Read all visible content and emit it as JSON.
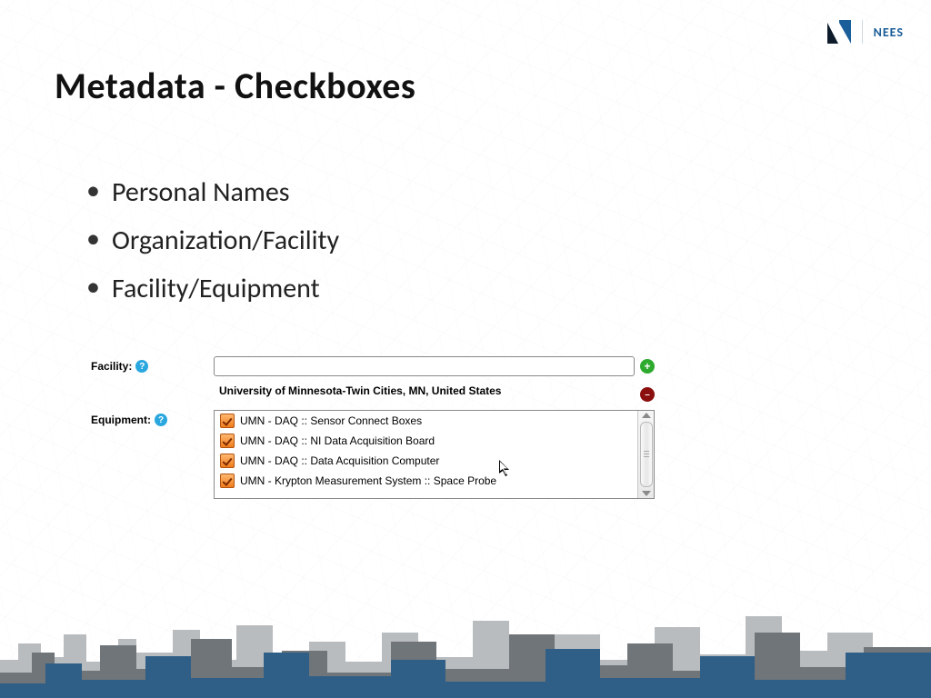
{
  "brand": "NEES",
  "title": "Metadata - Checkboxes",
  "bullets": [
    "Personal Names",
    "Organization/Facility",
    "Facility/Equipment"
  ],
  "form": {
    "facility_label": "Facility:",
    "equipment_label": "Equipment:",
    "facility_input_value": "",
    "facility_selected": "University of Minnesota-Twin Cities, MN, United States",
    "equipment": [
      "UMN - DAQ :: Sensor Connect Boxes",
      "UMN - DAQ :: NI Data Acquisition Board",
      "UMN - DAQ :: Data Acquisition Computer",
      "UMN - Krypton Measurement System :: Space Probe"
    ]
  }
}
